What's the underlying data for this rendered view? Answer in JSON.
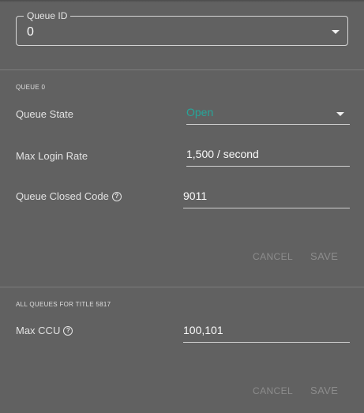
{
  "queue_id": {
    "legend": "Queue ID",
    "value": "0"
  },
  "queue_section": {
    "title": "QUEUE 0",
    "queue_state": {
      "label": "Queue State",
      "value": "Open",
      "value_color": "#26a69a"
    },
    "max_login_rate": {
      "label": "Max Login Rate",
      "value": "1,500 / second"
    },
    "queue_closed_code": {
      "label": "Queue Closed Code",
      "value": "9011",
      "help_icon": "?"
    },
    "cancel_label": "CANCEL",
    "save_label": "SAVE"
  },
  "all_queues_section": {
    "title": "ALL QUEUES FOR TITLE 5817",
    "max_ccu": {
      "label": "Max CCU",
      "value": "100,101",
      "help_icon": "?"
    },
    "cancel_label": "CANCEL",
    "save_label": "SAVE"
  }
}
